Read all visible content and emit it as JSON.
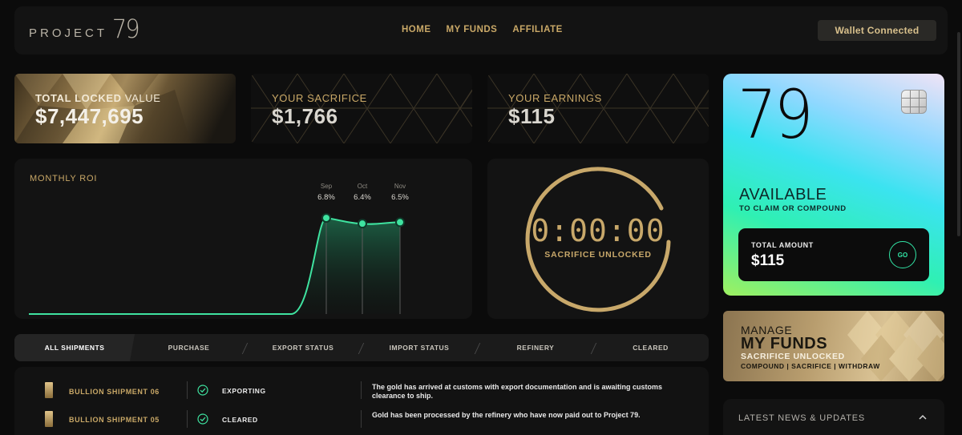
{
  "header": {
    "logo_word": "PROJECT",
    "logo_num": "79",
    "nav": [
      "HOME",
      "MY FUNDS",
      "AFFILIATE"
    ],
    "wallet_label": "Wallet Connected"
  },
  "stats": {
    "tlv_label_bold": "TOTAL LOCKED",
    "tlv_label_rest": " VALUE",
    "tlv_value": "$7,447,695",
    "sacrifice_label": "YOUR SACRIFICE",
    "sacrifice_value": "$1,766",
    "earnings_label": "YOUR EARNINGS",
    "earnings_value": "$115"
  },
  "roi": {
    "title": "MONTHLY ROI"
  },
  "chart_data": {
    "type": "area",
    "title": "MONTHLY ROI",
    "categories": [
      "Sep",
      "Oct",
      "Nov"
    ],
    "values": [
      6.8,
      6.4,
      6.5
    ],
    "labels": [
      "6.8%",
      "6.4%",
      "6.5%"
    ],
    "baseline": 0,
    "grid": false,
    "colors": {
      "line": "#3fe3a0",
      "fill_top": "#1e6b4c"
    }
  },
  "timer": {
    "digits": "0:00:00",
    "caption": "SACRIFICE UNLOCKED"
  },
  "card": {
    "number": "79",
    "available": "AVAILABLE",
    "sub": "TO CLAIM OR COMPOUND",
    "total_label": "TOTAL AMOUNT",
    "total_value": "$115",
    "go_label": "GO"
  },
  "manage": {
    "line1": "MANAGE",
    "line2": "MY FUNDS",
    "line3": "SACRIFICE UNLOCKED",
    "line4": "COMPOUND | SACRIFICE | WITHDRAW"
  },
  "news": {
    "title": "LATEST NEWS & UPDATES"
  },
  "tabs": [
    "ALL SHIPMENTS",
    "PURCHASE",
    "EXPORT STATUS",
    "IMPORT STATUS",
    "REFINERY",
    "CLEARED"
  ],
  "shipments": [
    {
      "name": "BULLION SHIPMENT 06",
      "status": "EXPORTING",
      "desc": "The gold has arrived at customs with export documentation and is awaiting customs clearance to ship."
    },
    {
      "name": "BULLION SHIPMENT 05",
      "status": "CLEARED",
      "desc": "Gold has been processed by the refinery who have now paid out to Project 79."
    }
  ],
  "colors": {
    "gold": "#c9a867",
    "accent_green": "#3fe3a0",
    "bg": "#0b0b0b"
  }
}
